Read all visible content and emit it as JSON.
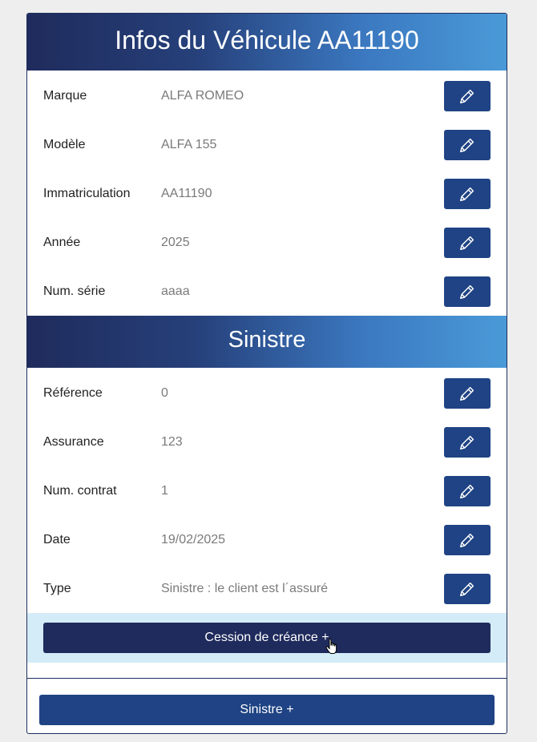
{
  "vehicle": {
    "title": "Infos du Véhicule AA11190",
    "fields": [
      {
        "label": "Marque",
        "value": "ALFA ROMEO"
      },
      {
        "label": "Modèle",
        "value": "ALFA 155"
      },
      {
        "label": "Immatriculation",
        "value": "AA11190"
      },
      {
        "label": "Année",
        "value": "2025"
      },
      {
        "label": "Num. série",
        "value": "aaaa"
      }
    ]
  },
  "sinistre": {
    "title": "Sinistre",
    "fields": [
      {
        "label": "Référence",
        "value": "0"
      },
      {
        "label": "Assurance",
        "value": "123"
      },
      {
        "label": "Num. contrat",
        "value": "1"
      },
      {
        "label": "Date",
        "value": "19/02/2025"
      },
      {
        "label": "Type",
        "value": "Sinistre : le client est l´assuré"
      }
    ],
    "cession_label": "Cession de créance +"
  },
  "footer": {
    "add_sinistre_label": "Sinistre +"
  },
  "icons": {
    "edit": "pencil-icon"
  },
  "colors": {
    "header_gradient_start": "#1f2b5c",
    "header_gradient_end": "#4a9ad8",
    "edit_button": "#1f4384",
    "cession_button": "#1f2b5c",
    "cession_bar": "#d4ecf7"
  }
}
